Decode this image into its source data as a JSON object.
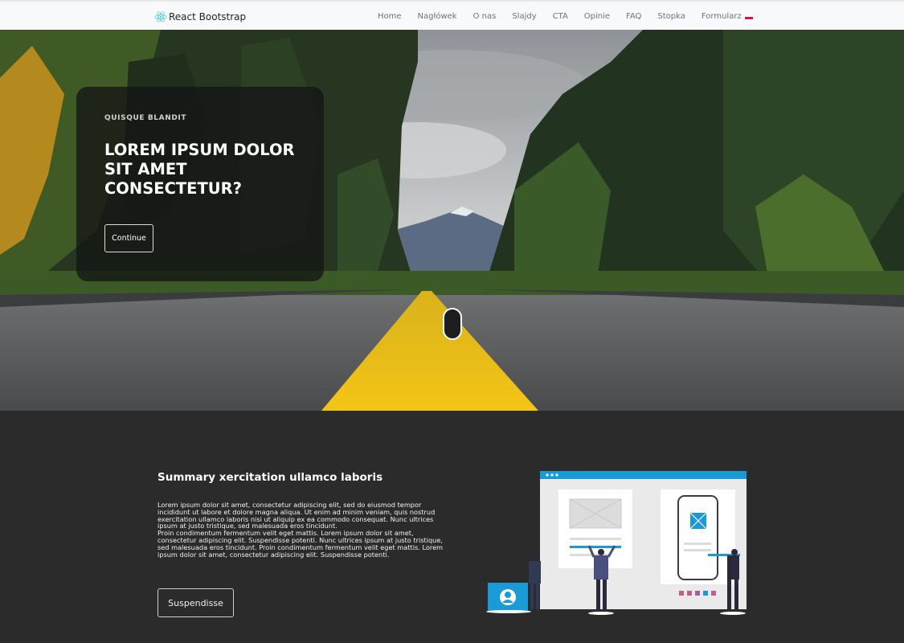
{
  "navbar": {
    "brand": "React Bootstrap",
    "brand_icon": "react-logo-icon",
    "links": [
      {
        "label": "Home"
      },
      {
        "label": "Nagłówek"
      },
      {
        "label": "O nas"
      },
      {
        "label": "Slajdy"
      },
      {
        "label": "CTA"
      },
      {
        "label": "Opinie"
      },
      {
        "label": "FAQ"
      },
      {
        "label": "Stopka"
      },
      {
        "label": "Formularz"
      }
    ],
    "language_icon": "poland-flag-icon"
  },
  "hero": {
    "eyebrow": "QUISQUE BLANDIT",
    "title": "LOREM IPSUM DOLOR SIT AMET CONSECTETUR?",
    "button_label": "Continue",
    "background": "forest-road-photo",
    "scroll_icon": "scroll-mouse-icon"
  },
  "summary": {
    "title": "Summary xercitation ullamco laboris",
    "text_1": "Lorem ipsum dolor sit amet, consectetur adipiscing elit, sed do eiusmod tempor incididunt ut labore et dolore magna aliqua. Ut enim ad minim veniam, quis nostrud exercitation ullamco laboris nisi ut aliquip ex ea commodo consequat. Nunc ultrices ipsum at justo tristique, sed malesuada eros tincidunt.",
    "text_2": "Proin condimentum fermentum velit eget mattis. Lorem ipsum dolor sit amet, consectetur adipiscing elit. Suspendisse potenti. Nunc ultrices ipsum at justo tristique, sed malesuada eros tincidunt. Proin condimentum fermentum velit eget mattis. Lorem ipsum dolor sit amet, consectetur adipiscing elit. Suspendisse potenti.",
    "button_label": "Suspendisse",
    "illustration": "website-builder-illustration"
  },
  "colors": {
    "navbar_bg": "#f8f9fa",
    "section_bg": "#2b2b2b",
    "accent_blue": "#0a8dd0",
    "road_line": "#f2c31a"
  }
}
